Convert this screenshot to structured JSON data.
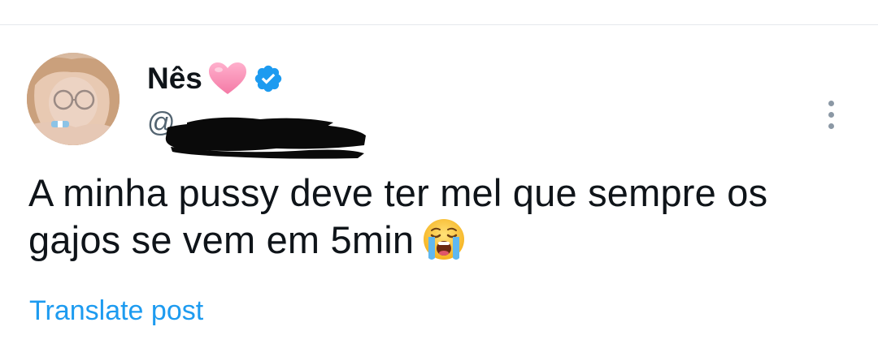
{
  "post": {
    "author": {
      "display_name": "Nês",
      "handle_prefix": "@",
      "handle_redacted": true,
      "name_emoji": "pink-heart-icon",
      "verified_badge": "verified-badge-icon"
    },
    "text_line_1": "A minha pussy deve ter mel que sempre os",
    "text_line_2": "gajos se vem em 5min",
    "text_emoji": "loudly-crying-face-icon",
    "translate_label": "Translate post",
    "more_menu_icon": "more-vertical-icon"
  },
  "colors": {
    "text_primary": "#0f1419",
    "text_secondary": "#536471",
    "link": "#1d9bf0",
    "verified": "#1d9bf0",
    "heart": "#f78fb3"
  }
}
